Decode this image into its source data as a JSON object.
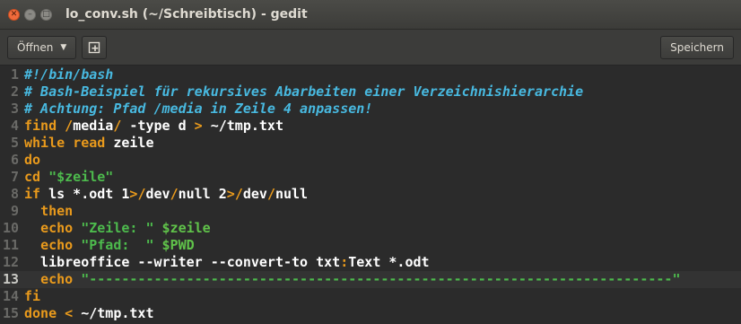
{
  "window": {
    "title": "lo_conv.sh (~/Schreibtisch) - gedit"
  },
  "toolbar": {
    "open_label": "Öffnen",
    "save_label": "Speichern"
  },
  "icons": {
    "close": "close-icon",
    "minimize": "minimize-icon",
    "maximize": "maximize-icon",
    "dropdown": "chevron-down-icon",
    "new_document": "new-document-icon"
  },
  "editor": {
    "current_line": 13,
    "lines": [
      {
        "n": "1",
        "tokens": [
          {
            "t": "#!/bin/bash",
            "c": "cm"
          }
        ]
      },
      {
        "n": "2",
        "tokens": [
          {
            "t": "# Bash-Beispiel für rekursives Abarbeiten einer Verzeichnishierarchie",
            "c": "cm"
          }
        ]
      },
      {
        "n": "3",
        "tokens": [
          {
            "t": "# Achtung: Pfad /media in Zeile 4 anpassen!",
            "c": "cm"
          }
        ]
      },
      {
        "n": "4",
        "tokens": [
          {
            "t": "find",
            "c": "kw"
          },
          {
            "t": " ",
            "c": "tx"
          },
          {
            "t": "/",
            "c": "op"
          },
          {
            "t": "media",
            "c": "tx"
          },
          {
            "t": "/",
            "c": "op"
          },
          {
            "t": " -type d ",
            "c": "tx"
          },
          {
            "t": ">",
            "c": "op"
          },
          {
            "t": " ~/tmp.txt",
            "c": "tx"
          }
        ]
      },
      {
        "n": "5",
        "tokens": [
          {
            "t": "while",
            "c": "kw"
          },
          {
            "t": " ",
            "c": "tx"
          },
          {
            "t": "read",
            "c": "kw"
          },
          {
            "t": " zeile",
            "c": "tx"
          }
        ]
      },
      {
        "n": "6",
        "tokens": [
          {
            "t": "do",
            "c": "kw"
          }
        ]
      },
      {
        "n": "7",
        "tokens": [
          {
            "t": "cd",
            "c": "kw"
          },
          {
            "t": " ",
            "c": "tx"
          },
          {
            "t": "\"$zeile\"",
            "c": "str"
          }
        ]
      },
      {
        "n": "8",
        "tokens": [
          {
            "t": "if",
            "c": "kw"
          },
          {
            "t": " ls *.odt 1",
            "c": "tx"
          },
          {
            "t": ">",
            "c": "op"
          },
          {
            "t": "/",
            "c": "op"
          },
          {
            "t": "dev",
            "c": "tx"
          },
          {
            "t": "/",
            "c": "op"
          },
          {
            "t": "null 2",
            "c": "tx"
          },
          {
            "t": ">",
            "c": "op"
          },
          {
            "t": "/",
            "c": "op"
          },
          {
            "t": "dev",
            "c": "tx"
          },
          {
            "t": "/",
            "c": "op"
          },
          {
            "t": "null",
            "c": "tx"
          }
        ]
      },
      {
        "n": "9",
        "tokens": [
          {
            "t": "  ",
            "c": "tx"
          },
          {
            "t": "then",
            "c": "kw"
          }
        ]
      },
      {
        "n": "10",
        "tokens": [
          {
            "t": "  ",
            "c": "tx"
          },
          {
            "t": "echo",
            "c": "kw"
          },
          {
            "t": " ",
            "c": "tx"
          },
          {
            "t": "\"Zeile: \"",
            "c": "str"
          },
          {
            "t": " ",
            "c": "tx"
          },
          {
            "t": "$zeile",
            "c": "var"
          }
        ]
      },
      {
        "n": "11",
        "tokens": [
          {
            "t": "  ",
            "c": "tx"
          },
          {
            "t": "echo",
            "c": "kw"
          },
          {
            "t": " ",
            "c": "tx"
          },
          {
            "t": "\"Pfad:  \"",
            "c": "str"
          },
          {
            "t": " ",
            "c": "tx"
          },
          {
            "t": "$PWD",
            "c": "var"
          }
        ]
      },
      {
        "n": "12",
        "tokens": [
          {
            "t": "  libreoffice --writer --convert-to txt",
            "c": "tx"
          },
          {
            "t": ":",
            "c": "op"
          },
          {
            "t": "Text *.odt",
            "c": "tx"
          }
        ]
      },
      {
        "n": "13",
        "tokens": [
          {
            "t": "  ",
            "c": "tx"
          },
          {
            "t": "echo",
            "c": "kw"
          },
          {
            "t": " ",
            "c": "tx"
          },
          {
            "t": "\"------------------------------------------------------------------------\"",
            "c": "str"
          }
        ]
      },
      {
        "n": "14",
        "tokens": [
          {
            "t": "fi",
            "c": "kw"
          }
        ]
      },
      {
        "n": "15",
        "tokens": [
          {
            "t": "done",
            "c": "kw"
          },
          {
            "t": " ",
            "c": "tx"
          },
          {
            "t": "<",
            "c": "op"
          },
          {
            "t": " ~/tmp.txt",
            "c": "tx"
          }
        ]
      }
    ]
  }
}
